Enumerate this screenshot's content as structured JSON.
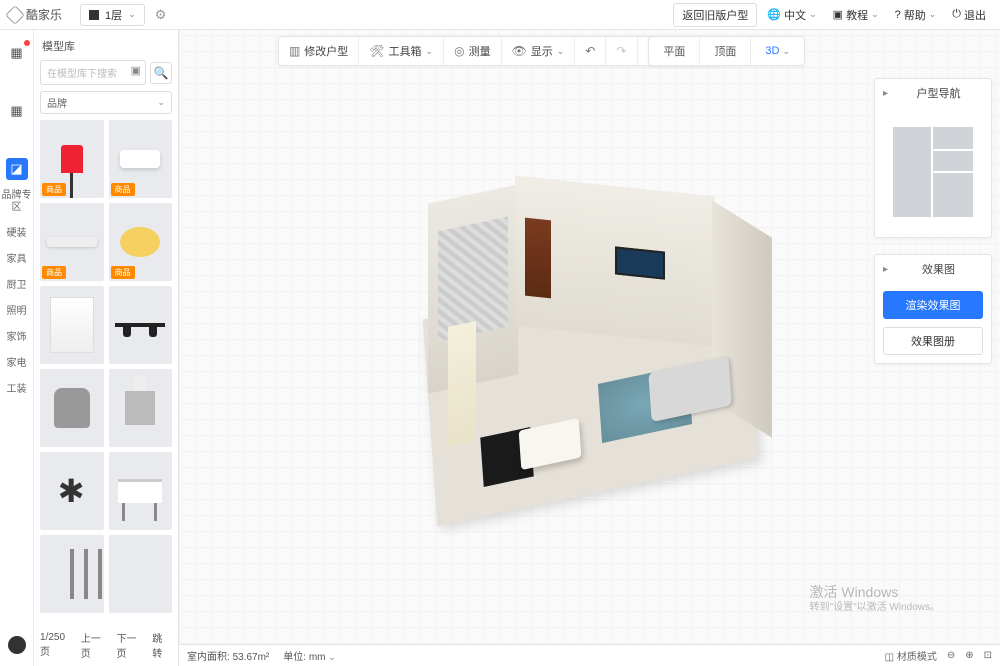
{
  "header": {
    "logo_text": "酷家乐",
    "floor_label": "1层",
    "back_old": "返回旧版户型",
    "lang": "中文",
    "tutorial": "教程",
    "help": "帮助",
    "exit": "退出"
  },
  "leftrail": {
    "categories": [
      "品牌专区",
      "硬装",
      "家具",
      "厨卫",
      "照明",
      "家饰",
      "家电",
      "工装"
    ]
  },
  "panel": {
    "title": "模型库",
    "search_placeholder": "在模型库下搜索",
    "brand_label": "品牌",
    "tag_product": "商品",
    "pager_total": "1/250页",
    "pager_prev": "上一页",
    "pager_next": "下一页",
    "pager_jump": "跳转"
  },
  "toolbar": {
    "modify": "修改户型",
    "toolbox": "工具箱",
    "measure": "测量",
    "display": "显示"
  },
  "viewbar": {
    "plan": "平面",
    "ceiling": "顶面",
    "three_d": "3D"
  },
  "right": {
    "nav_title": "户型导航",
    "render_title": "效果图",
    "btn_render": "渲染效果图",
    "btn_album": "效果图册"
  },
  "status": {
    "area_label": "室内面积:",
    "area_value": "53.67m²",
    "unit_label": "单位:",
    "unit_value": "mm",
    "material_mode": "材质模式"
  },
  "watermark": {
    "line1": "激活 Windows",
    "line2": "转到\"设置\"以激活 Windows。"
  }
}
